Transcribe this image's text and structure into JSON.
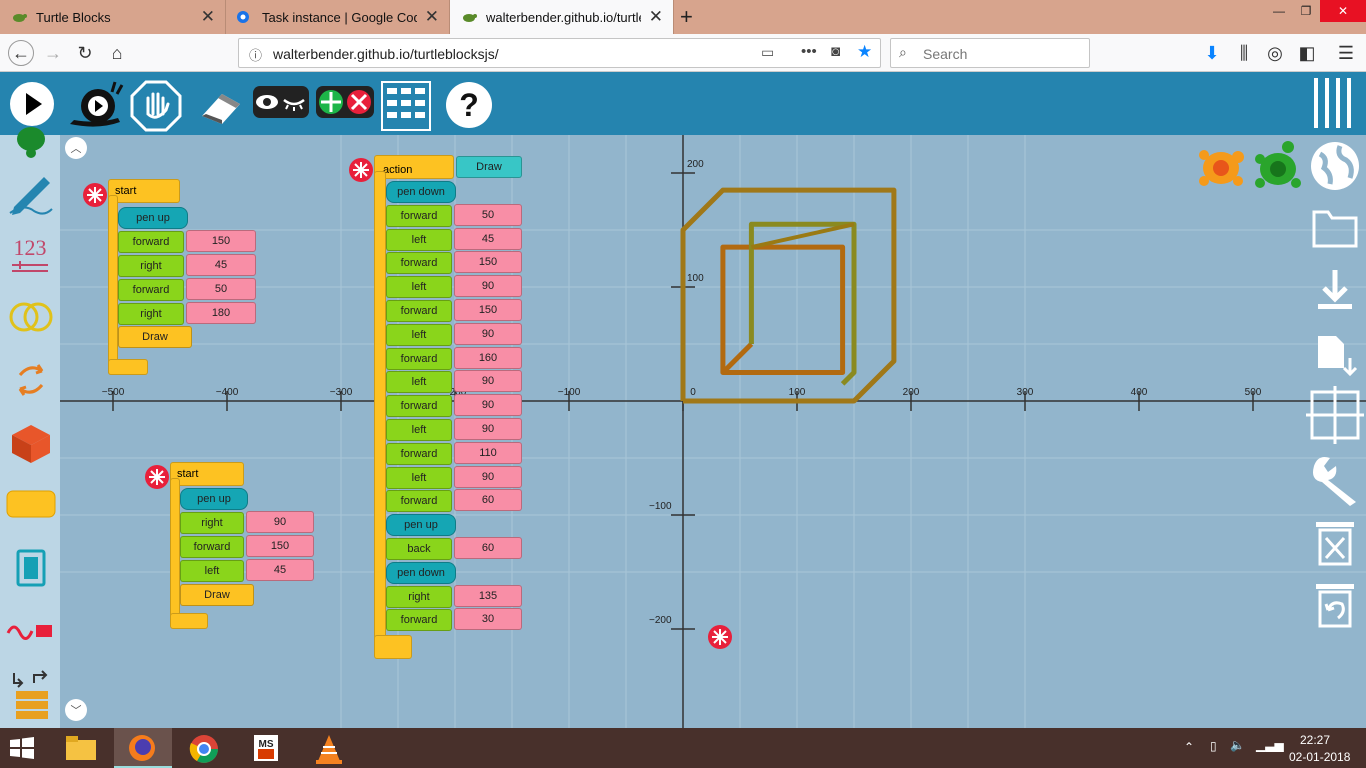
{
  "browser": {
    "tabs": [
      {
        "label": "Turtle Blocks"
      },
      {
        "label": "Task instance | Google Code-in"
      },
      {
        "label": "walterbender.github.io/turtlebl"
      }
    ],
    "url": "walterbender.github.io/turtleblocksjs/",
    "search_placeholder": "Search"
  },
  "blocks": {
    "stack1": {
      "start": "start",
      "rows": [
        {
          "label": "pen up",
          "kind": "pen"
        },
        {
          "label": "forward",
          "value": "150"
        },
        {
          "label": "right",
          "value": "45"
        },
        {
          "label": "forward",
          "value": "50"
        },
        {
          "label": "right",
          "value": "180"
        }
      ],
      "call": "Draw"
    },
    "stack2": {
      "start": "start",
      "rows": [
        {
          "label": "pen up",
          "kind": "pen"
        },
        {
          "label": "right",
          "value": "90"
        },
        {
          "label": "forward",
          "value": "150"
        },
        {
          "label": "left",
          "value": "45"
        }
      ],
      "call": "Draw"
    },
    "action": {
      "label": "action",
      "name": "Draw",
      "rows": [
        {
          "label": "pen down",
          "kind": "pen"
        },
        {
          "label": "forward",
          "value": "50"
        },
        {
          "label": "left",
          "value": "45"
        },
        {
          "label": "forward",
          "value": "150"
        },
        {
          "label": "left",
          "value": "90"
        },
        {
          "label": "forward",
          "value": "150"
        },
        {
          "label": "left",
          "value": "90"
        },
        {
          "label": "forward",
          "value": "160"
        },
        {
          "label": "left",
          "value": "90"
        },
        {
          "label": "forward",
          "value": "90"
        },
        {
          "label": "left",
          "value": "90"
        },
        {
          "label": "forward",
          "value": "110"
        },
        {
          "label": "left",
          "value": "90"
        },
        {
          "label": "forward",
          "value": "60"
        },
        {
          "label": "pen up",
          "kind": "pen"
        },
        {
          "label": "back",
          "value": "60"
        },
        {
          "label": "pen down",
          "kind": "pen"
        },
        {
          "label": "right",
          "value": "135"
        },
        {
          "label": "forward",
          "value": "30"
        }
      ]
    }
  },
  "grid": {
    "x_ticks": [
      "−500",
      "−400",
      "−300",
      "−200",
      "−100",
      "0",
      "100",
      "200",
      "300",
      "400",
      "500"
    ],
    "y_ticks": [
      "200",
      "100",
      "−100",
      "−200"
    ]
  },
  "taskbar": {
    "time": "22:27",
    "date": "02-01-2018"
  },
  "colors": {
    "toolbar": "#2584af",
    "canvas": "#92b5cc",
    "palette": "#bcd6e5",
    "block_green": "#8ad51b",
    "block_teal": "#15a6b4",
    "block_yellow": "#fdc222",
    "block_pink": "#f88ea6",
    "drawing_stroke": "#a07818"
  },
  "icons": {
    "toolbar": [
      "play-icon",
      "slow-play-snail-icon",
      "stop-hand-icon",
      "eraser-icon",
      "show-hide-blocks-icon",
      "collapse-expand-icon",
      "grid-menu-icon",
      "help-icon"
    ],
    "right": [
      "menu-bars-icon",
      "globe-icon",
      "folder-icon",
      "download-icon",
      "new-file-icon",
      "grid-target-icon",
      "wrench-icon",
      "trash-icon",
      "restore-icon"
    ],
    "palette": [
      "turtle-icon",
      "pen-icon",
      "number-icon",
      "boolean-rings-icon",
      "flow-icon",
      "box-icon",
      "action-icon",
      "media-icon",
      "sensor-icon",
      "extras-icon"
    ]
  }
}
